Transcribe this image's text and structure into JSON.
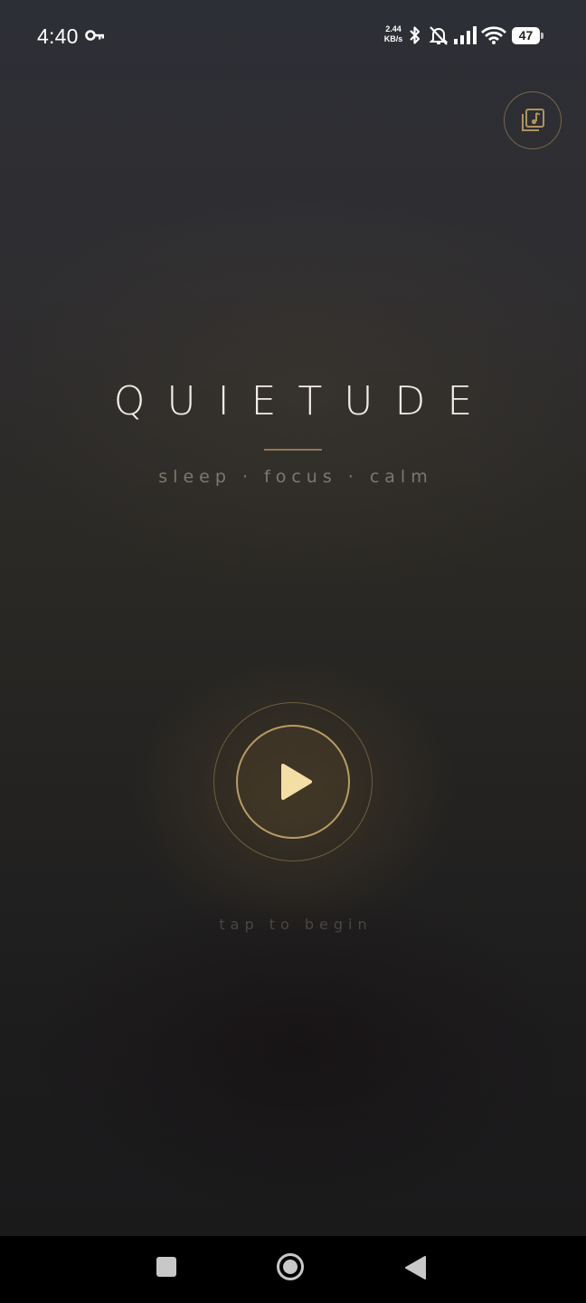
{
  "status_bar": {
    "time": "4:40",
    "net_speed_value": "2.44",
    "net_speed_unit": "KB/s",
    "battery_level": "47",
    "icons": [
      "key-icon",
      "bluetooth-icon",
      "notifications-off-icon",
      "signal-icon",
      "wifi-icon",
      "battery-icon"
    ]
  },
  "header": {
    "library_icon": "music-library-icon"
  },
  "hero": {
    "title": "QUIETUDE",
    "tagline": "sleep · focus · calm"
  },
  "player": {
    "play_icon": "play-icon",
    "hint": "tap to begin"
  },
  "nav_bar": {
    "icons": [
      "recents-icon",
      "home-icon",
      "back-icon"
    ]
  },
  "colors": {
    "accent_gold": "#b79c66",
    "play_glyph": "#f3dfa6",
    "title_text": "#f2eee6"
  }
}
